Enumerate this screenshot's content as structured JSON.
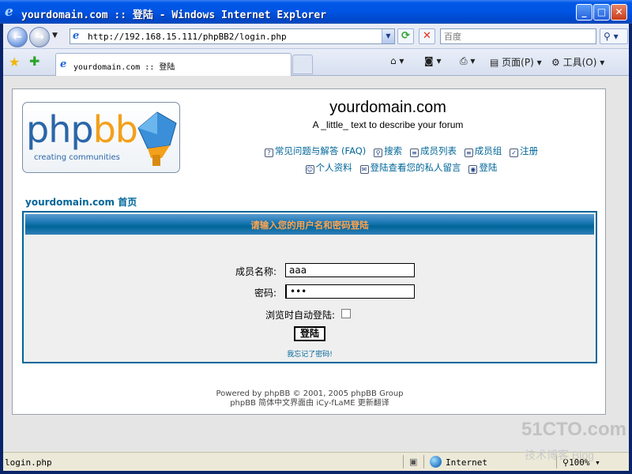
{
  "window": {
    "title": "yourdomain.com :: 登陆 - Windows Internet Explorer",
    "min_label": "_",
    "max_label": "□",
    "close_label": "✕"
  },
  "address_bar": {
    "url": "http://192.168.15.111/phpBB2/login.php"
  },
  "search": {
    "placeholder": "百度"
  },
  "tab": {
    "label": "yourdomain.com :: 登陆"
  },
  "toolbar": {
    "page_label": "页面(P)",
    "tools_label": "工具(O)"
  },
  "site": {
    "title": "yourdomain.com",
    "description": "A _little_ text to describe your forum",
    "logo_text_a": "php",
    "logo_text_b": "bb",
    "logo_tagline": "creating communities"
  },
  "nav": {
    "line1": [
      {
        "label": "常见问题与解答 (FAQ)",
        "icon": "faq-icon"
      },
      {
        "label": "搜索",
        "icon": "search-icon"
      },
      {
        "label": "成员列表",
        "icon": "members-icon"
      },
      {
        "label": "成员组",
        "icon": "groups-icon"
      },
      {
        "label": "注册",
        "icon": "register-icon"
      }
    ],
    "line2": [
      {
        "label": "个人资料",
        "icon": "profile-icon"
      },
      {
        "label": "登陆查看您的私人留言",
        "icon": "messages-icon"
      },
      {
        "label": "登陆",
        "icon": "login-icon"
      }
    ]
  },
  "breadcrumb": "yourdomain.com 首页",
  "login": {
    "header": "请输入您的用户名和密码登陆",
    "username_label": "成员名称:",
    "username_value": "aaa",
    "password_label": "密码:",
    "password_value": "•••",
    "autologin_label": "浏览时自动登陆:",
    "submit_label": "登陆",
    "forgot_link": "我忘记了密码!"
  },
  "footer": {
    "line1": "Powered by phpBB © 2001, 2005 phpBB Group",
    "line2": "phpBB 简体中文界面由 iCy-fLaME 更新翻译"
  },
  "statusbar": {
    "text": "login.php",
    "zone": "Internet",
    "zoom": "100%"
  },
  "watermark": {
    "line1": "51CTO.com",
    "line2": "技术博客 Blog"
  }
}
